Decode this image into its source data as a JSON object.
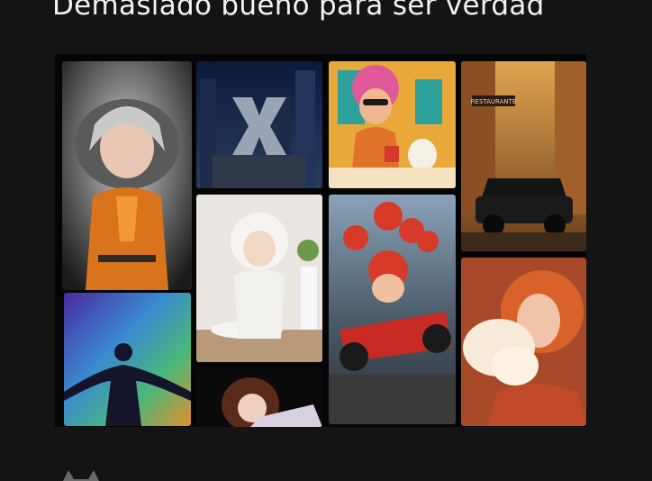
{
  "post": {
    "title": "Demasiado bueno para ser verdad"
  },
  "gallery": {
    "items": [
      {
        "id": "armored-girl",
        "subject": "silver-haired girl in orange suit"
      },
      {
        "id": "x-logo-city",
        "subject": "X logo in city"
      },
      {
        "id": "cartoon-cafe",
        "subject": "cartoon girl with cat"
      },
      {
        "id": "vintage-car-street",
        "subject": "vintage car street",
        "sign_text": "RESTAURANTE"
      },
      {
        "id": "baby-costume",
        "subject": "baby in fluffy costume"
      },
      {
        "id": "kart-racer",
        "subject": "kart racer with balloons"
      },
      {
        "id": "aurora-silhouette",
        "subject": "silhouette with aurora"
      },
      {
        "id": "red-hair-portrait",
        "subject": "red-haired woman with smoke"
      },
      {
        "id": "anime-girl",
        "subject": "anime girl"
      }
    ]
  },
  "colors": {
    "background": "#141414",
    "title": "#f2f2f2"
  },
  "footer": {
    "avatar_icon": "cat-avatar-icon"
  }
}
